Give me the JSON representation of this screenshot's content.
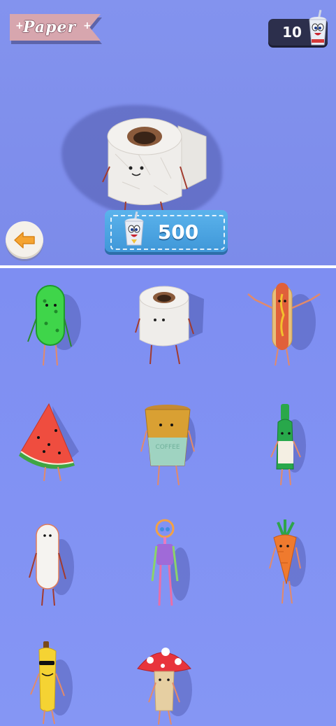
{
  "header": {
    "category_title": "Paper",
    "currency_amount": "10",
    "currency_icon": "cup-mascot-icon"
  },
  "preview": {
    "selected_character": "toilet-paper-roll",
    "price": "500",
    "price_icon": "cup-mascot-icon"
  },
  "navigation": {
    "back_icon": "arrow-left-icon"
  },
  "characters": [
    {
      "name": "pickle"
    },
    {
      "name": "toilet-paper-roll"
    },
    {
      "name": "hot-dog"
    },
    {
      "name": "watermelon-slice"
    },
    {
      "name": "coffee-cup"
    },
    {
      "name": "soda-bottle"
    },
    {
      "name": "tofu-bar"
    },
    {
      "name": "ring-head-figure"
    },
    {
      "name": "carrot"
    },
    {
      "name": "banana"
    },
    {
      "name": "mushroom"
    }
  ],
  "colors": {
    "background": "#7f8ef0",
    "ribbon": "#d7a6ae",
    "counter": "#2c2f4c",
    "price_button": "#4aa5e2"
  }
}
